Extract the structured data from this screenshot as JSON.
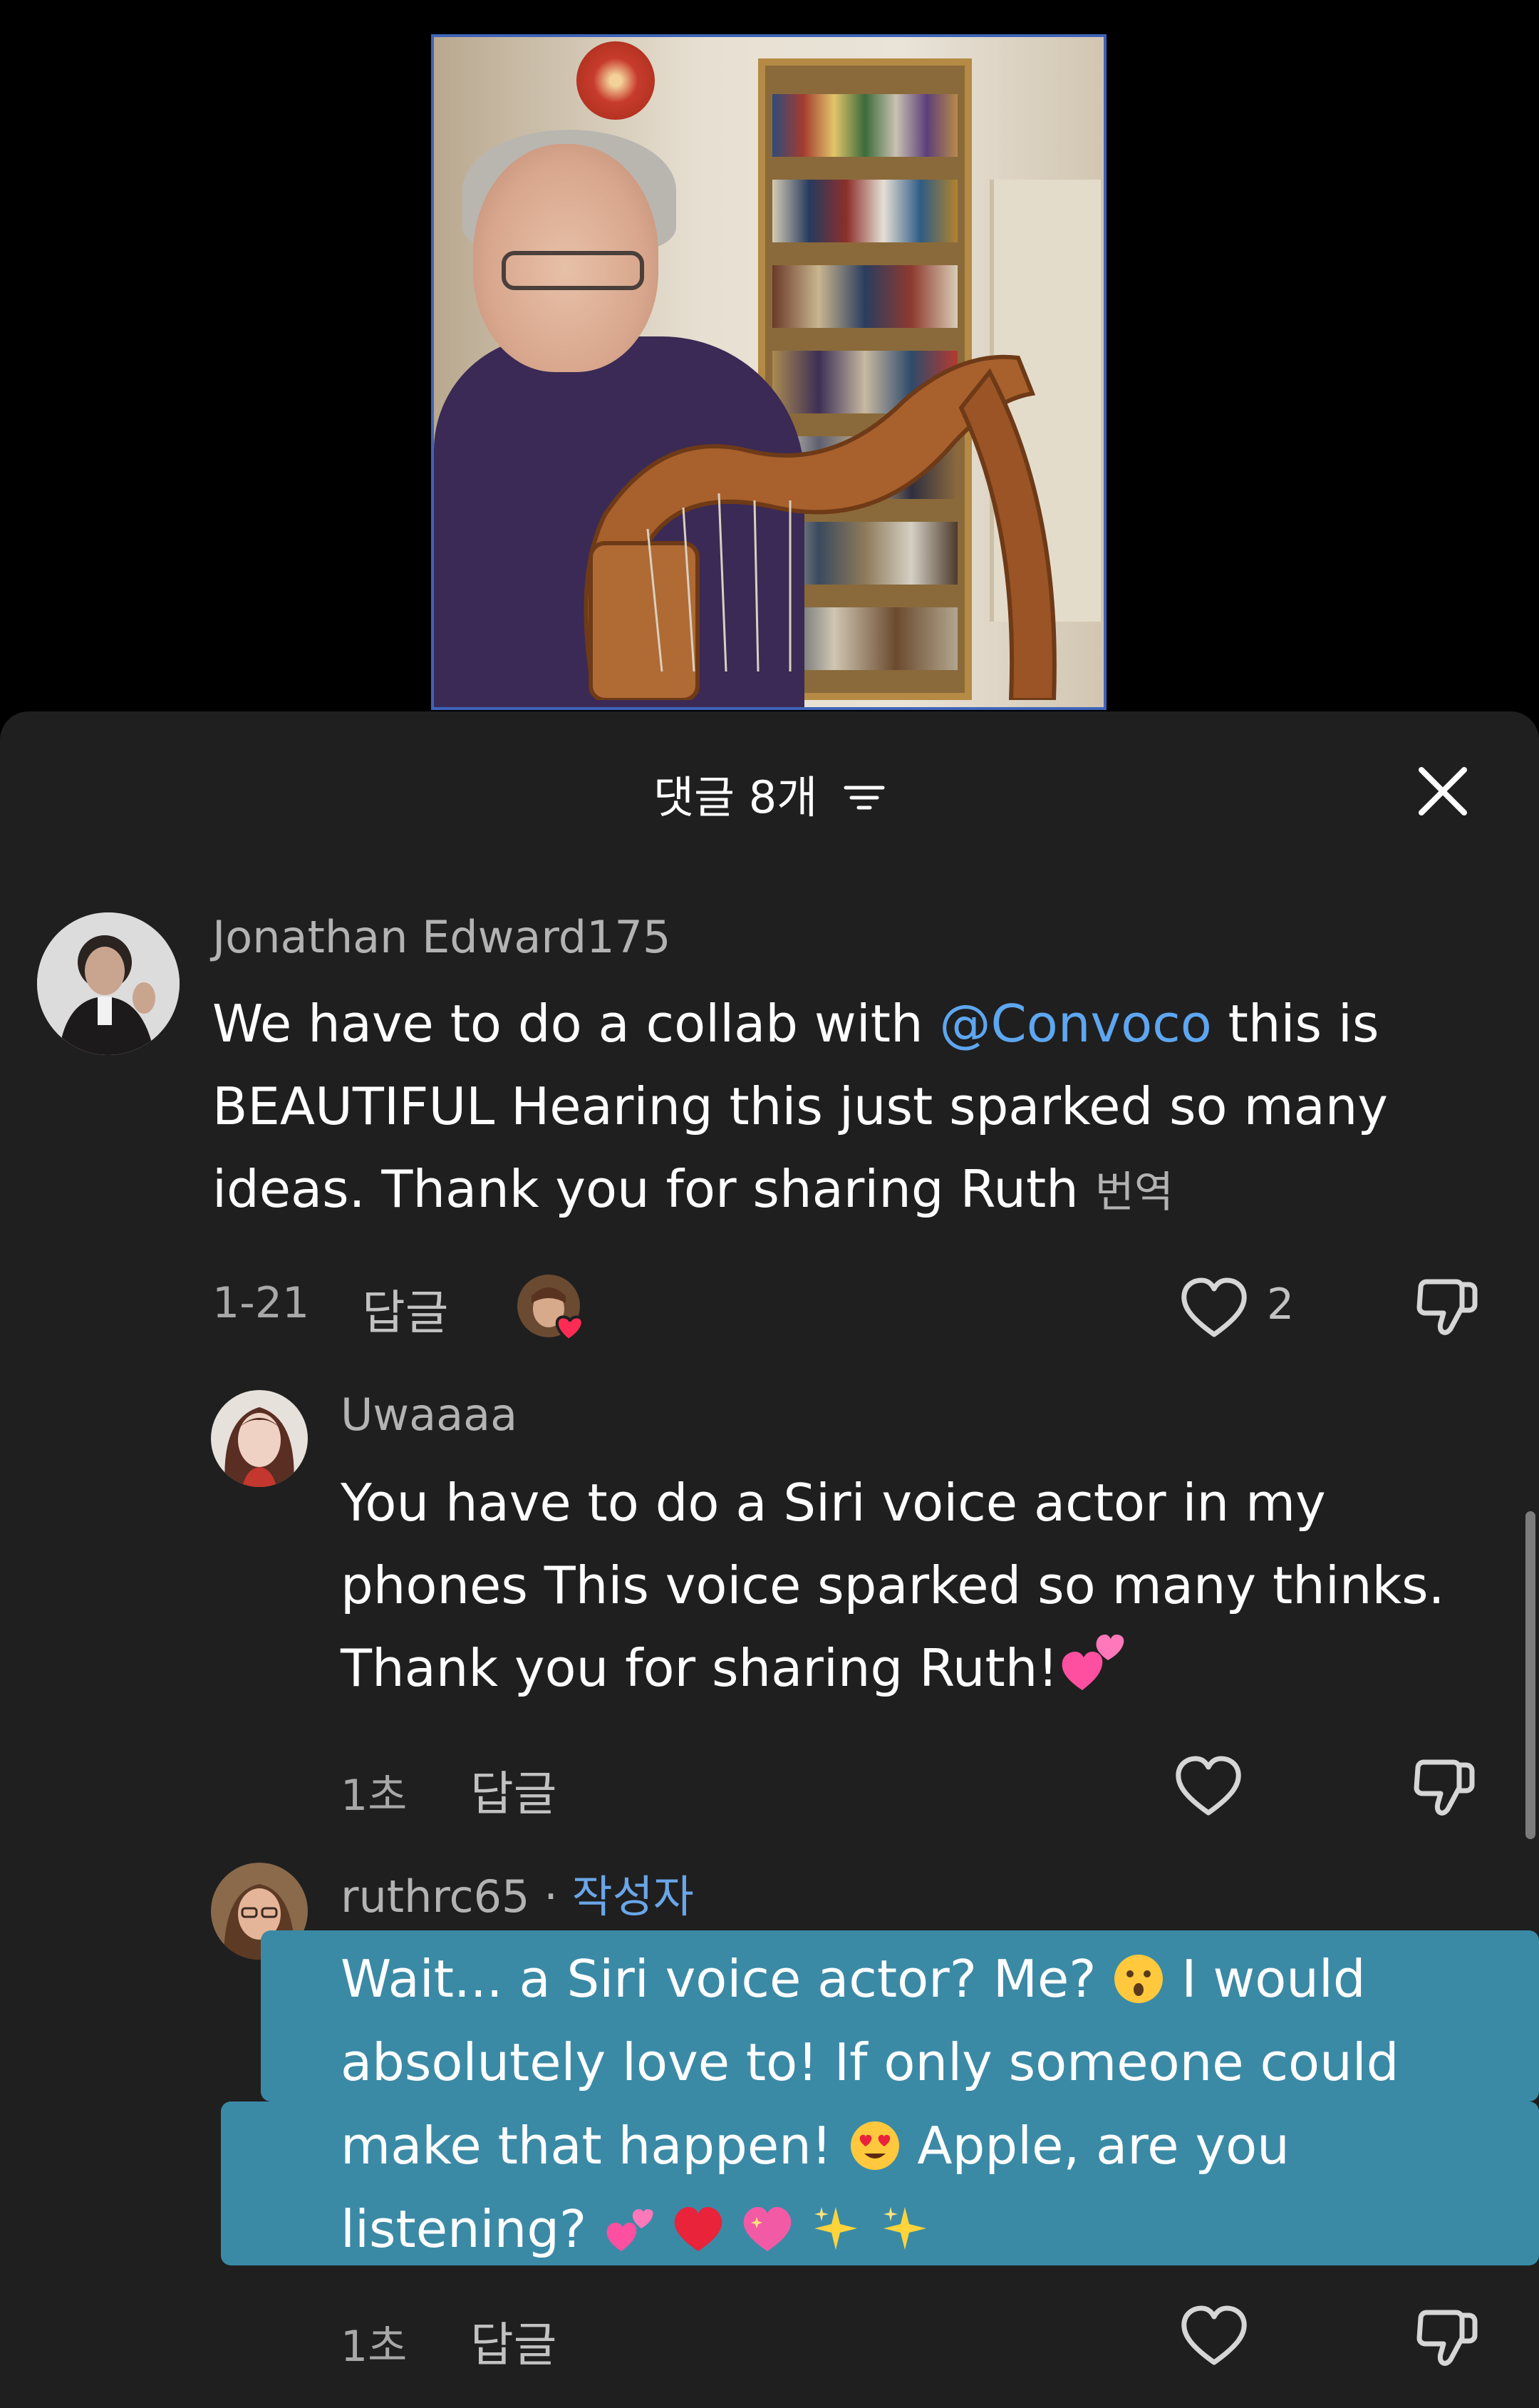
{
  "header": {
    "comment_count_label": "댓글 8개"
  },
  "comments": [
    {
      "username": "Jonathan Edward175",
      "text_before_mention": "We have to do a collab with ",
      "mention": "@Convoco",
      "text_after_mention": " this is BEAUTIFUL Hearing this just sparked so many ideas. Thank you for sharing Ruth",
      "translate_label": "번역",
      "date": "1-21",
      "reply_label": "답글",
      "like_count": "2"
    },
    {
      "username": "Uwaaaa",
      "text": "You have to do a Siri voice actor in my phones This voice sparked so many thinks. Thank you for sharing Ruth!",
      "emoji": "💕",
      "date": "1초",
      "reply_label": "답글"
    },
    {
      "username": "ruthrc65",
      "separator": " · ",
      "author_tag": "작성자",
      "line1": "Wait... a Siri voice actor? Me?",
      "line1_end": " I would",
      "line2": "absolutely love to! If only someone could",
      "line3": "make that happen!",
      "line3_end": " Apple, are you",
      "line4": "listening?",
      "emojis": [
        "😮",
        "😍",
        "💕",
        "❤️",
        "💖",
        "✨",
        "✨"
      ],
      "date": "1초",
      "reply_label": "답글"
    }
  ],
  "colors": {
    "sheet_bg": "#1f1f1f",
    "mention": "#5ea6f0",
    "author_tag": "#6aa6e8",
    "highlight": "#3a8aa6",
    "heart_badge": "#fe2c55"
  }
}
